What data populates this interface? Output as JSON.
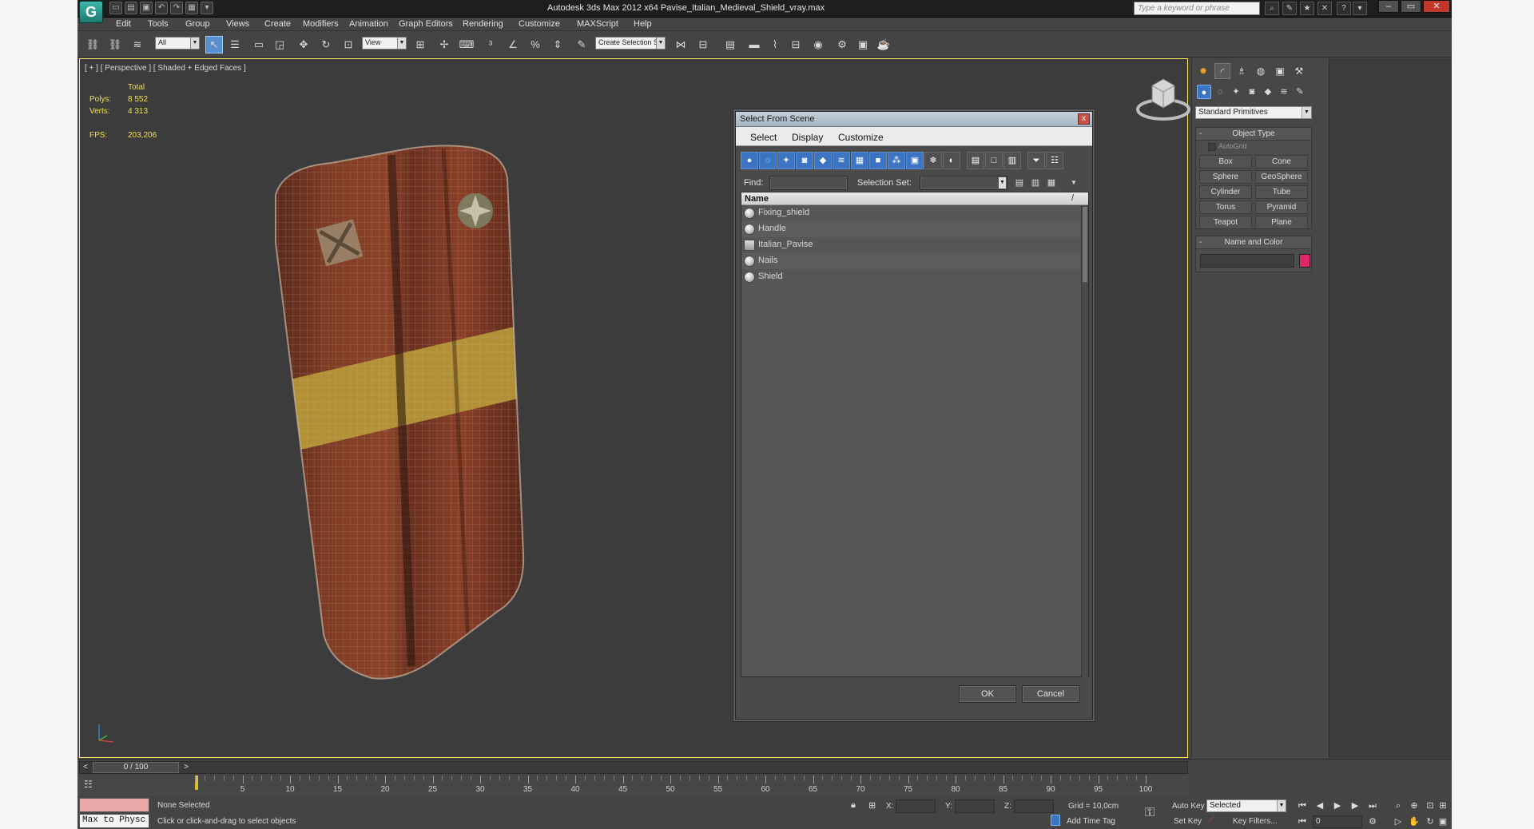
{
  "title": "Autodesk 3ds Max  2012 x64      Pavise_Italian_Medieval_Shield_vray.max",
  "logo_text": "G",
  "search_placeholder": "Type a keyword or phrase",
  "menu": [
    "Edit",
    "Tools",
    "Group",
    "Views",
    "Create",
    "Modifiers",
    "Animation",
    "Graph Editors",
    "Rendering",
    "Customize",
    "MAXScript",
    "Help"
  ],
  "toolbar": {
    "filter_value": "All",
    "refcoord_value": "View",
    "selection_set_value": "Create Selection Se"
  },
  "viewport": {
    "label": "[ + ] [ Perspective ] [ Shaded + Edged Faces ]",
    "stats_header": "Total",
    "polys_label": "Polys:",
    "polys_value": "8 552",
    "verts_label": "Verts:",
    "verts_value": "4 313",
    "fps_label": "FPS:",
    "fps_value": "203,206"
  },
  "dialog": {
    "title": "Select From Scene",
    "close": "x",
    "menu": [
      "Select",
      "Display",
      "Customize"
    ],
    "find_label": "Find:",
    "find_value": "",
    "selset_label": "Selection Set:",
    "selset_value": "",
    "column_name": "Name",
    "sort_glyph": "/",
    "items": [
      "Fixing_shield",
      "Handle",
      "Italian_Pavise",
      "Nails",
      "Shield"
    ],
    "ok": "OK",
    "cancel": "Cancel"
  },
  "command_panel": {
    "category": "Standard Primitives",
    "object_type_title": "Object Type",
    "autogrid": "AutoGrid",
    "primitives": [
      "Box",
      "Cone",
      "Sphere",
      "GeoSphere",
      "Cylinder",
      "Tube",
      "Torus",
      "Pyramid",
      "Teapot",
      "Plane"
    ],
    "name_color_title": "Name and Color",
    "object_color": "#e0266a",
    "rollout_toggle": "-"
  },
  "timeline": {
    "frame_display": "0 / 100",
    "ticks": [
      5,
      10,
      15,
      20,
      25,
      30,
      35,
      40,
      45,
      50,
      55,
      60,
      65,
      70,
      75,
      80,
      85,
      90,
      95,
      100
    ]
  },
  "status": {
    "maxscript": "Max to Physc",
    "selection": "None Selected",
    "prompt": "Click or click-and-drag to select objects",
    "x_label": "X:",
    "y_label": "Y:",
    "z_label": "Z:",
    "grid": "Grid = 10,0cm",
    "add_time_tag": "Add Time Tag",
    "auto_key": "Auto Key",
    "set_key": "Set Key",
    "selected_value": "Selected",
    "key_filters": "Key Filters...",
    "frame_value": "0"
  },
  "colors": {
    "accent": "#3a74c2",
    "viewport_border": "#ffe86a",
    "stats_text": "#f2e04a"
  }
}
